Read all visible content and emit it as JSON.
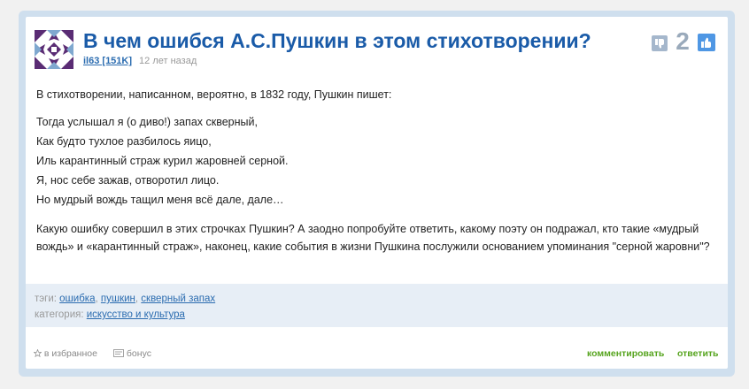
{
  "question": {
    "title": "В чем ошибся А.С.Пушкин в этом стихотворении?",
    "author": "il63 [151K]",
    "time_ago": "12 лет назад",
    "rating": "2",
    "intro": "В стихотворении, написанном, вероятно, в 1832 году, Пушкин пишет:",
    "poem_lines": [
      "Тогда услышал я (о диво!) запах скверный,",
      "Как будто тухлое разбилось яицо,",
      "Иль карантинный страж курил жаровней серной.",
      "Я, нос себе зажав, отворотил лицо.",
      "Но мудрый вождь тащил меня всё дале, дале…"
    ],
    "question_text": "Какую ошибку совершил в этих строчках Пушкин? А заодно попробуйте ответить, какому поэту он подражал, кто такие «мудрый вождь» и «карантинный страж», наконец, какие события в жизни Пушкина послужили основанием упоминания \"серной жаровни\"?"
  },
  "tags": {
    "label": "тэги:",
    "items": [
      "ошибка",
      "пушкин",
      "скверный запах"
    ],
    "separator": ","
  },
  "category": {
    "label": "категория:",
    "value": "искусство и культура"
  },
  "footer": {
    "favorite_label": "в избранное",
    "bonus_label": "бонус",
    "comment_label": "комментировать",
    "reply_label": "ответить"
  },
  "icons": {
    "avatar": "avatar-icon",
    "vote_down": "thumbs-down-icon",
    "vote_up": "thumbs-up-icon",
    "favorite": "star-icon",
    "bonus": "bonus-icon"
  },
  "colors": {
    "title": "#1a5ba8",
    "link": "#2b6cb0",
    "action": "#56a41e",
    "frame": "#cfdfee",
    "tags_band": "#e7eef6",
    "vote_up": "#4f97e4",
    "vote_down": "#a5b7cc",
    "avatar_primary": "#5a2c74",
    "avatar_secondary": "#7fa8cf"
  }
}
